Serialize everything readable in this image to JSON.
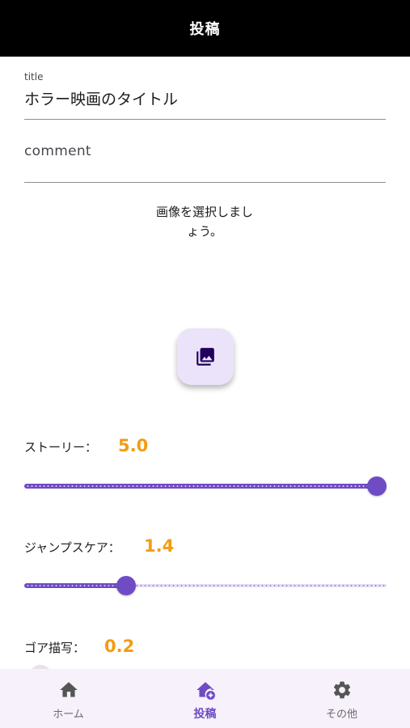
{
  "app_bar": {
    "title": "投稿"
  },
  "form": {
    "title_field": {
      "label": "title",
      "value": "ホラー映画のタイトル"
    },
    "comment_field": {
      "placeholder": "comment",
      "value": ""
    }
  },
  "image_picker": {
    "prompt_line1": "画像を選択しまし",
    "prompt_line2": "ょう。",
    "icon": "photo-library-icon"
  },
  "ratings": [
    {
      "label": "ストーリー：",
      "value": "5.0",
      "min": 0,
      "max": 5,
      "fraction": 1.0
    },
    {
      "label": "ジャンプスケア：",
      "value": "1.4",
      "min": 0,
      "max": 5,
      "fraction": 0.28
    },
    {
      "label": "ゴア描写：",
      "value": "0.2",
      "min": 0,
      "max": 5,
      "fraction": 0.04
    }
  ],
  "bottom_nav": {
    "items": [
      {
        "label": "ホーム",
        "icon": "home-icon",
        "active": false
      },
      {
        "label": "投稿",
        "icon": "add-home-icon",
        "active": true
      },
      {
        "label": "その他",
        "icon": "gear-icon",
        "active": false
      }
    ]
  },
  "colors": {
    "app_bar": "#000000",
    "accent": "#6f4cc4",
    "rating_value": "#f39c12",
    "nav_background": "#f6f1fa"
  }
}
